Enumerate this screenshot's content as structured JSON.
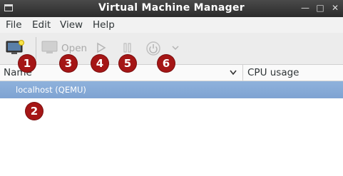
{
  "window": {
    "title": "Virtual Machine Manager"
  },
  "menu": [
    "File",
    "Edit",
    "View",
    "Help"
  ],
  "toolbar": {
    "open_label": "Open"
  },
  "columns": {
    "name": "Name",
    "cpu": "CPU usage"
  },
  "connections": [
    {
      "label": "localhost (QEMU)",
      "selected": true
    }
  ],
  "annotations": [
    "1",
    "2",
    "3",
    "4",
    "5",
    "6"
  ],
  "colors": {
    "badge": "#a51616",
    "selection": "#86aad6",
    "titlebar": "#3a3a3a"
  }
}
